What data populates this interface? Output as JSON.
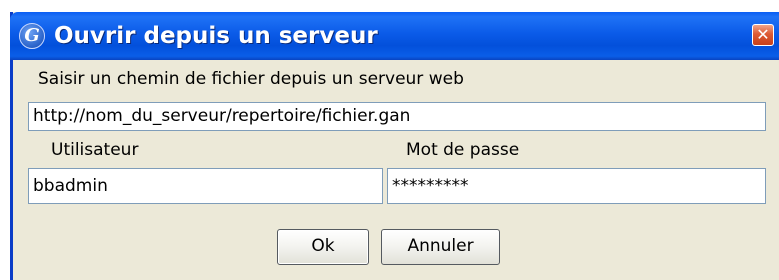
{
  "window": {
    "title": "Ouvrir depuis un serveur",
    "app_icon_glyph": "G",
    "close_glyph": "✕"
  },
  "form": {
    "url_label": "Saisir un chemin de fichier depuis un serveur web",
    "url_value": "http://nom_du_serveur/repertoire/fichier.gan",
    "user_label": "Utilisateur",
    "user_value": "bbadmin",
    "password_label": "Mot de passe",
    "password_value": "*********"
  },
  "buttons": {
    "ok_label": "Ok",
    "cancel_label": "Annuler"
  },
  "colors": {
    "titlebar": "#0b5be8",
    "dialog_bg": "#ece9d8",
    "close": "#dd5a33"
  }
}
